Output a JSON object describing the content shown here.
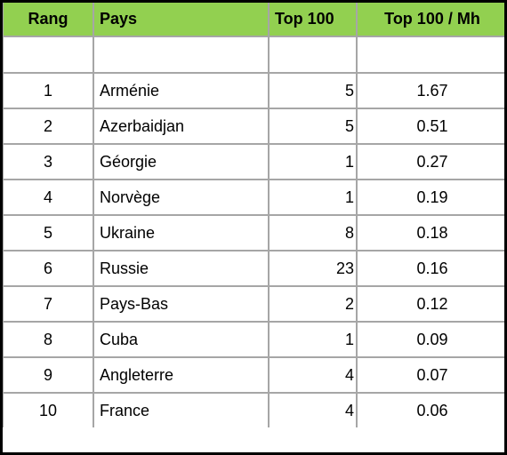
{
  "table": {
    "headers": {
      "rang": "Rang",
      "pays": "Pays",
      "top100": "Top 100",
      "top100_per_mh": "Top 100 / Mh"
    },
    "colors": {
      "header_background": "#92D050",
      "grid_lines": "#A6A6A6",
      "outer_border": "#000000"
    },
    "rows": [
      {
        "rang": "1",
        "pays": "Arménie",
        "top100": "5",
        "top100_per_mh": "1.67"
      },
      {
        "rang": "2",
        "pays": "Azerbaidjan",
        "top100": "5",
        "top100_per_mh": "0.51"
      },
      {
        "rang": "3",
        "pays": "Géorgie",
        "top100": "1",
        "top100_per_mh": "0.27"
      },
      {
        "rang": "4",
        "pays": "Norvège",
        "top100": "1",
        "top100_per_mh": "0.19"
      },
      {
        "rang": "5",
        "pays": "Ukraine",
        "top100": "8",
        "top100_per_mh": "0.18"
      },
      {
        "rang": "6",
        "pays": "Russie",
        "top100": "23",
        "top100_per_mh": "0.16"
      },
      {
        "rang": "7",
        "pays": "Pays-Bas",
        "top100": "2",
        "top100_per_mh": "0.12"
      },
      {
        "rang": "8",
        "pays": "Cuba",
        "top100": "1",
        "top100_per_mh": "0.09"
      },
      {
        "rang": "9",
        "pays": "Angleterre",
        "top100": "4",
        "top100_per_mh": "0.07"
      },
      {
        "rang": "10",
        "pays": "France",
        "top100": "4",
        "top100_per_mh": "0.06"
      }
    ]
  }
}
